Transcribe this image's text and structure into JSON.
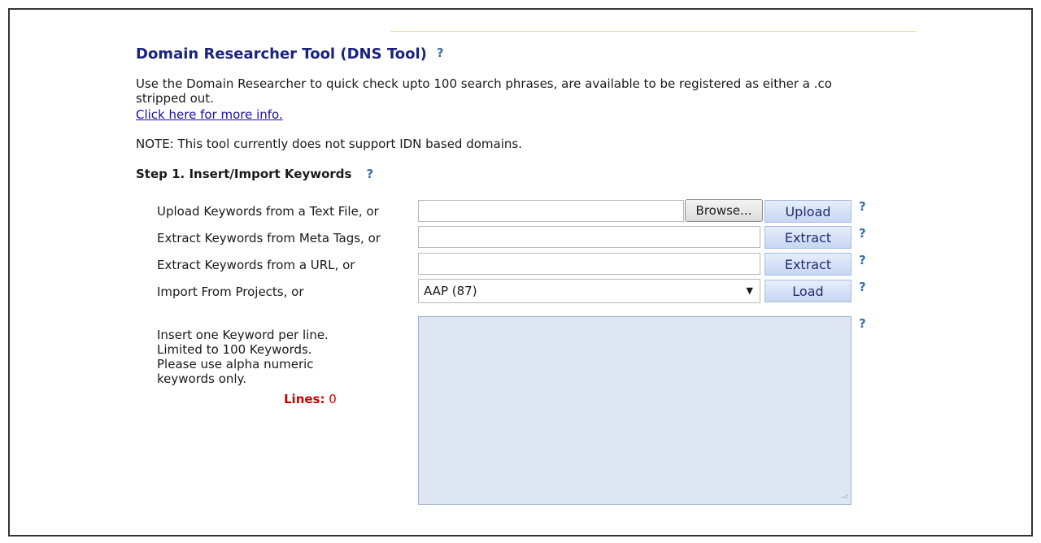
{
  "page": {
    "title": "Domain Researcher Tool (DNS Tool)",
    "help_glyph": "?",
    "description_line1": "Use the Domain Researcher to quick check upto 100 search phrases, are available to be registered as either a .co",
    "description_line2": "stripped out.",
    "more_info_link": "Click here for more info.",
    "note": "NOTE: This tool currently does not support IDN based domains."
  },
  "step1": {
    "heading": "Step 1. Insert/Import Keywords",
    "rows": [
      {
        "label": "Upload Keywords from a Text File, or",
        "input_value": "",
        "browse_label": "Browse...",
        "button_label": "Upload"
      },
      {
        "label": "Extract Keywords from Meta Tags, or",
        "input_value": "",
        "button_label": "Extract"
      },
      {
        "label": "Extract Keywords from a URL, or",
        "input_value": "",
        "button_label": "Extract"
      },
      {
        "label": "Import From Projects, or",
        "selected": "AAP (87)",
        "button_label": "Load"
      }
    ],
    "instructions": {
      "line1": "Insert one Keyword per line.",
      "line2": "Limited to 100 Keywords.",
      "line3": "Please use alpha numeric",
      "line4": "keywords only."
    },
    "lines_label": "Lines:",
    "lines_count": "0",
    "keywords_text": ""
  },
  "icons": {
    "help": "question-mark-icon",
    "dropdown": "caret-down-icon",
    "resize": "resize-grip-icon"
  },
  "colors": {
    "title": "#1a237e",
    "help": "#3b6ea8",
    "link": "#1a0dab",
    "lines_label": "#d00000",
    "button_bg": "#c7d6f3",
    "textarea_bg": "#dfe6f3"
  }
}
